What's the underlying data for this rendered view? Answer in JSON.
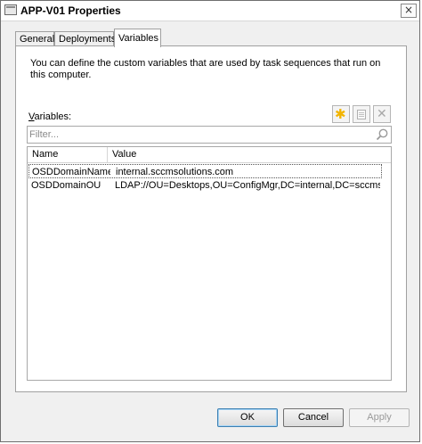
{
  "window": {
    "title": "APP-V01 Properties",
    "close_glyph": "×"
  },
  "tabs": [
    {
      "label": "General",
      "active": false
    },
    {
      "label": "Deployments",
      "active": false
    },
    {
      "label": "Variables",
      "active": true
    }
  ],
  "panel": {
    "description": "You can define the custom variables that are used by task sequences that run on this computer.",
    "variables_label_accel": "V",
    "variables_label_rest": "ariables:",
    "toolbar": {
      "new_icon": "new-star-icon",
      "properties_icon": "properties-icon",
      "delete_icon": "delete-x-icon"
    },
    "filter": {
      "placeholder": "Filter...",
      "value": ""
    },
    "columns": {
      "name": "Name",
      "value": "Value"
    },
    "rows": [
      {
        "name": "OSDDomainName",
        "value": "internal.sccmsolutions.com",
        "selected": true
      },
      {
        "name": "OSDDomainOU",
        "value": "LDAP://OU=Desktops,OU=ConfigMgr,DC=internal,DC=sccmsolut...",
        "selected": false
      }
    ]
  },
  "buttons": {
    "ok": "OK",
    "cancel": "Cancel",
    "apply": "Apply"
  },
  "colors": {
    "new_star": "#f2b400",
    "disabled_text": "#9a9a9a"
  }
}
